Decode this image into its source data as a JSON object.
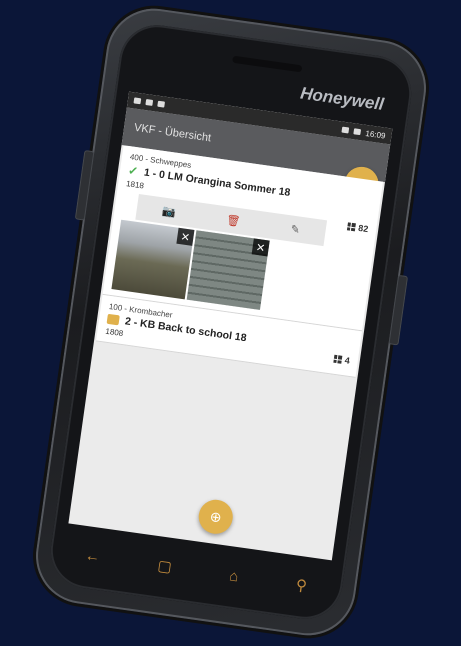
{
  "device": {
    "brand": "Honeywell"
  },
  "status_bar": {
    "time": "16:09"
  },
  "app_bar": {
    "title": "VKF - Übersicht"
  },
  "fab_back_icon": "arrow-left-icon",
  "fab_add_icon": "plus-circle-icon",
  "cards": [
    {
      "supplier": "400 - Schweppes",
      "title": "1 - 0 LM Orangina Sommer 18",
      "id": "1818",
      "count": "82",
      "status_icon": "checkmark-icon"
    },
    {
      "supplier": "100 - Krombacher",
      "title": "2 - KB Back to school 18",
      "id": "1808",
      "count": "4",
      "status_icon": "camera-icon"
    }
  ],
  "toolbar": {
    "camera_icon": "camera-icon",
    "delete_icon": "trash-icon",
    "edit_icon": "pencil-icon"
  },
  "photos": [
    {
      "remove": "✕"
    },
    {
      "remove": "✕"
    }
  ],
  "nav": {
    "back": "←",
    "recent": "▢",
    "home": "⌂",
    "search": "⚲"
  },
  "colors": {
    "accent": "#e0b14c",
    "background": "#0b1638"
  }
}
